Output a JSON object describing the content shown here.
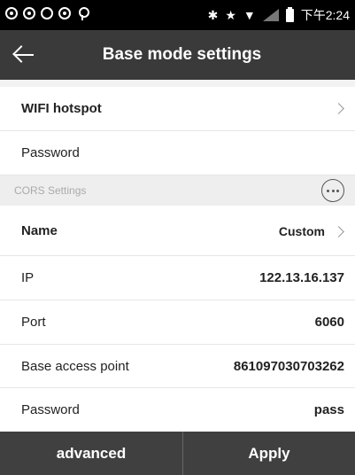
{
  "status_bar": {
    "time": "下午2:24",
    "icons": [
      "sync-icon",
      "sync-icon",
      "settings-icon",
      "sync-icon",
      "location-icon",
      "bluetooth-icon",
      "star-icon",
      "wifi-icon",
      "signal-icon",
      "battery-icon"
    ]
  },
  "app_bar": {
    "title": "Base mode settings",
    "back_icon": "back-arrow-icon"
  },
  "wifi": {
    "hotspot_label": "WIFI hotspot",
    "password_label": "Password"
  },
  "cors": {
    "section_title": "CORS Settings",
    "rows": [
      {
        "label": "Name",
        "value": "Custom"
      },
      {
        "label": "IP",
        "value": "122.13.16.137"
      },
      {
        "label": "Port",
        "value": "6060"
      },
      {
        "label": "Base access point",
        "value": "861097030703262"
      },
      {
        "label": "Password",
        "value": "pass"
      }
    ]
  },
  "bottom": {
    "advanced_label": "advanced",
    "apply_label": "Apply"
  }
}
